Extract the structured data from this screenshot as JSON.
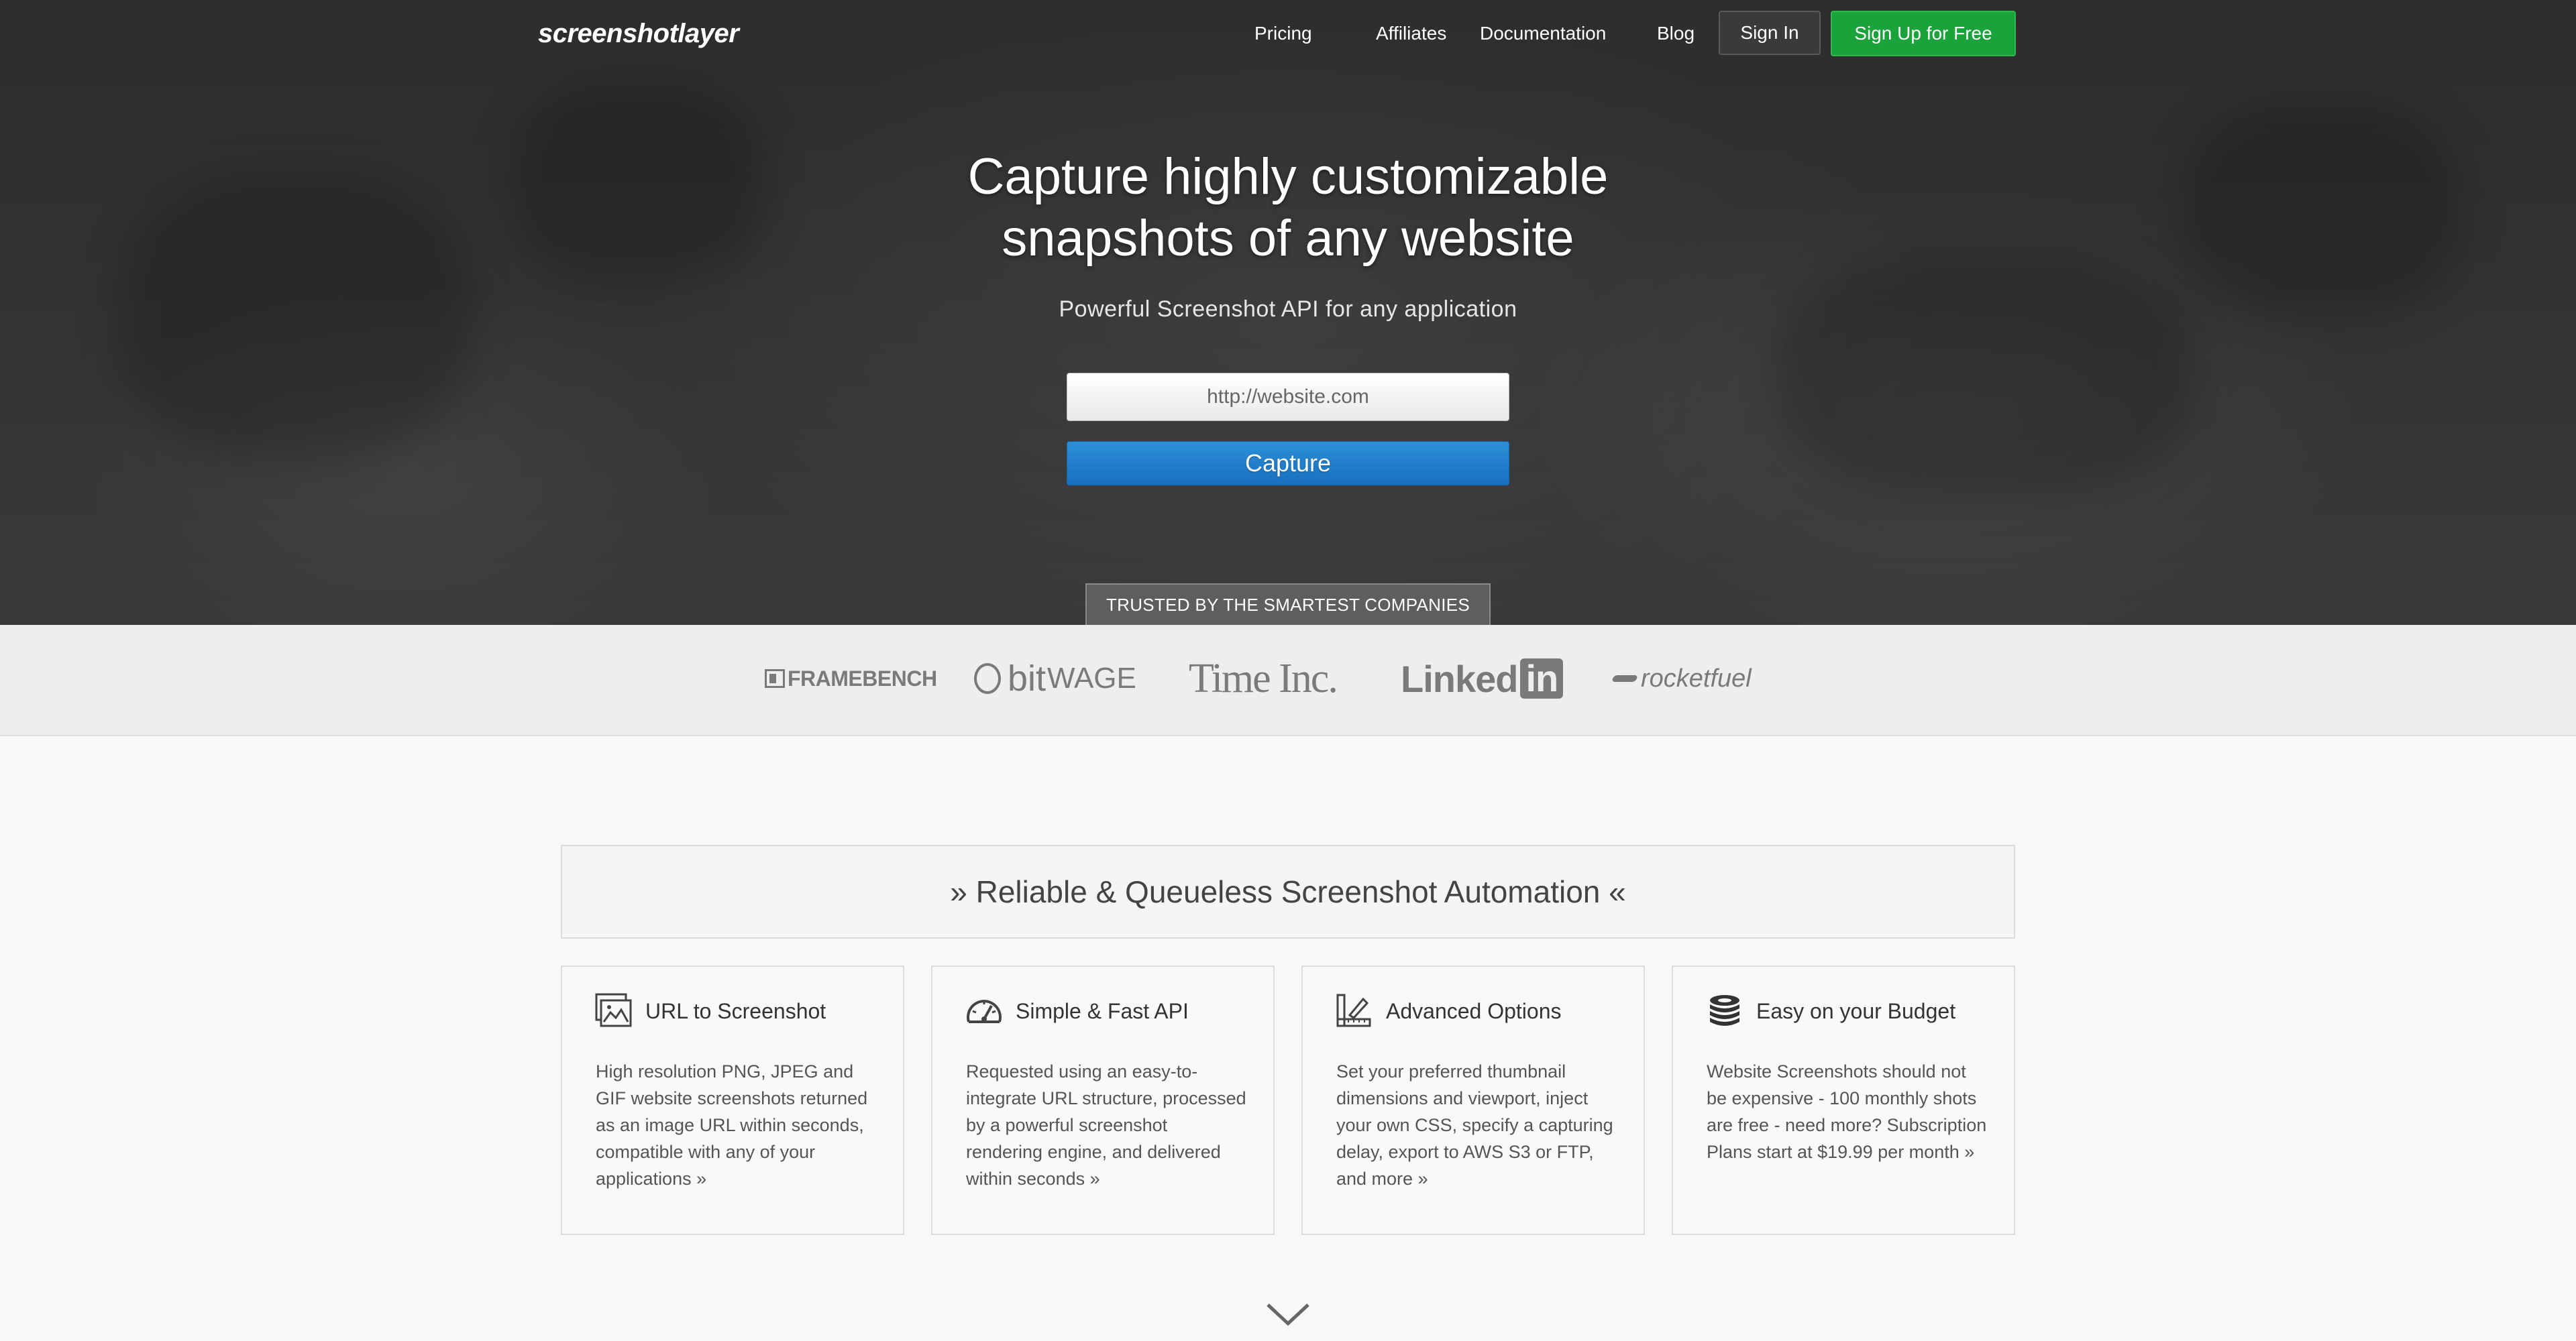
{
  "nav": {
    "logo": "screenshotlayer",
    "links": [
      "Pricing",
      "Affiliates",
      "Documentation",
      "Blog"
    ],
    "signin": "Sign In",
    "signup": "Sign Up for Free"
  },
  "hero": {
    "title_line1": "Capture highly customizable",
    "title_line2": "snapshots of any website",
    "subtitle": "Powerful Screenshot API for any application",
    "input_placeholder": "http://website.com",
    "capture_button": "Capture",
    "trusted_label": "TRUSTED BY THE SMARTEST COMPANIES"
  },
  "logos": {
    "framebench": "FRAMEBENCH",
    "bitwage_bit": "bit",
    "bitwage_wage": "WAGE",
    "timeinc": "Time Inc.",
    "linkedin_text": "Linked",
    "linkedin_box": "in",
    "rocketfuel": "rocketfuel"
  },
  "features": {
    "banner": "» Reliable & Queueless Screenshot Automation «",
    "cards": [
      {
        "icon": "image-icon",
        "title": "URL to Screenshot",
        "text": "High resolution PNG, JPEG and GIF website screenshots returned as an image URL within seconds, compatible with any of your applications »"
      },
      {
        "icon": "speedometer-icon",
        "title": "Simple & Fast API",
        "text": "Requested using an easy-to-integrate URL structure, processed by a powerful screenshot rendering engine, and delivered within seconds »"
      },
      {
        "icon": "design-tools-icon",
        "title": "Advanced Options",
        "text": "Set your preferred thumbnail dimensions and viewport, inject your own CSS, specify a capturing delay, export to AWS S3 or FTP, and more »"
      },
      {
        "icon": "coins-icon",
        "title": "Easy on your Budget",
        "text": "Website Screenshots should not be expensive - 100 monthly shots are free - need more? Subscription Plans start at $19.99 per month »"
      }
    ]
  },
  "colors": {
    "hero_bg": "#2f2f2f",
    "signup_green": "#1aa33a",
    "capture_blue": "#1f7fcc"
  }
}
